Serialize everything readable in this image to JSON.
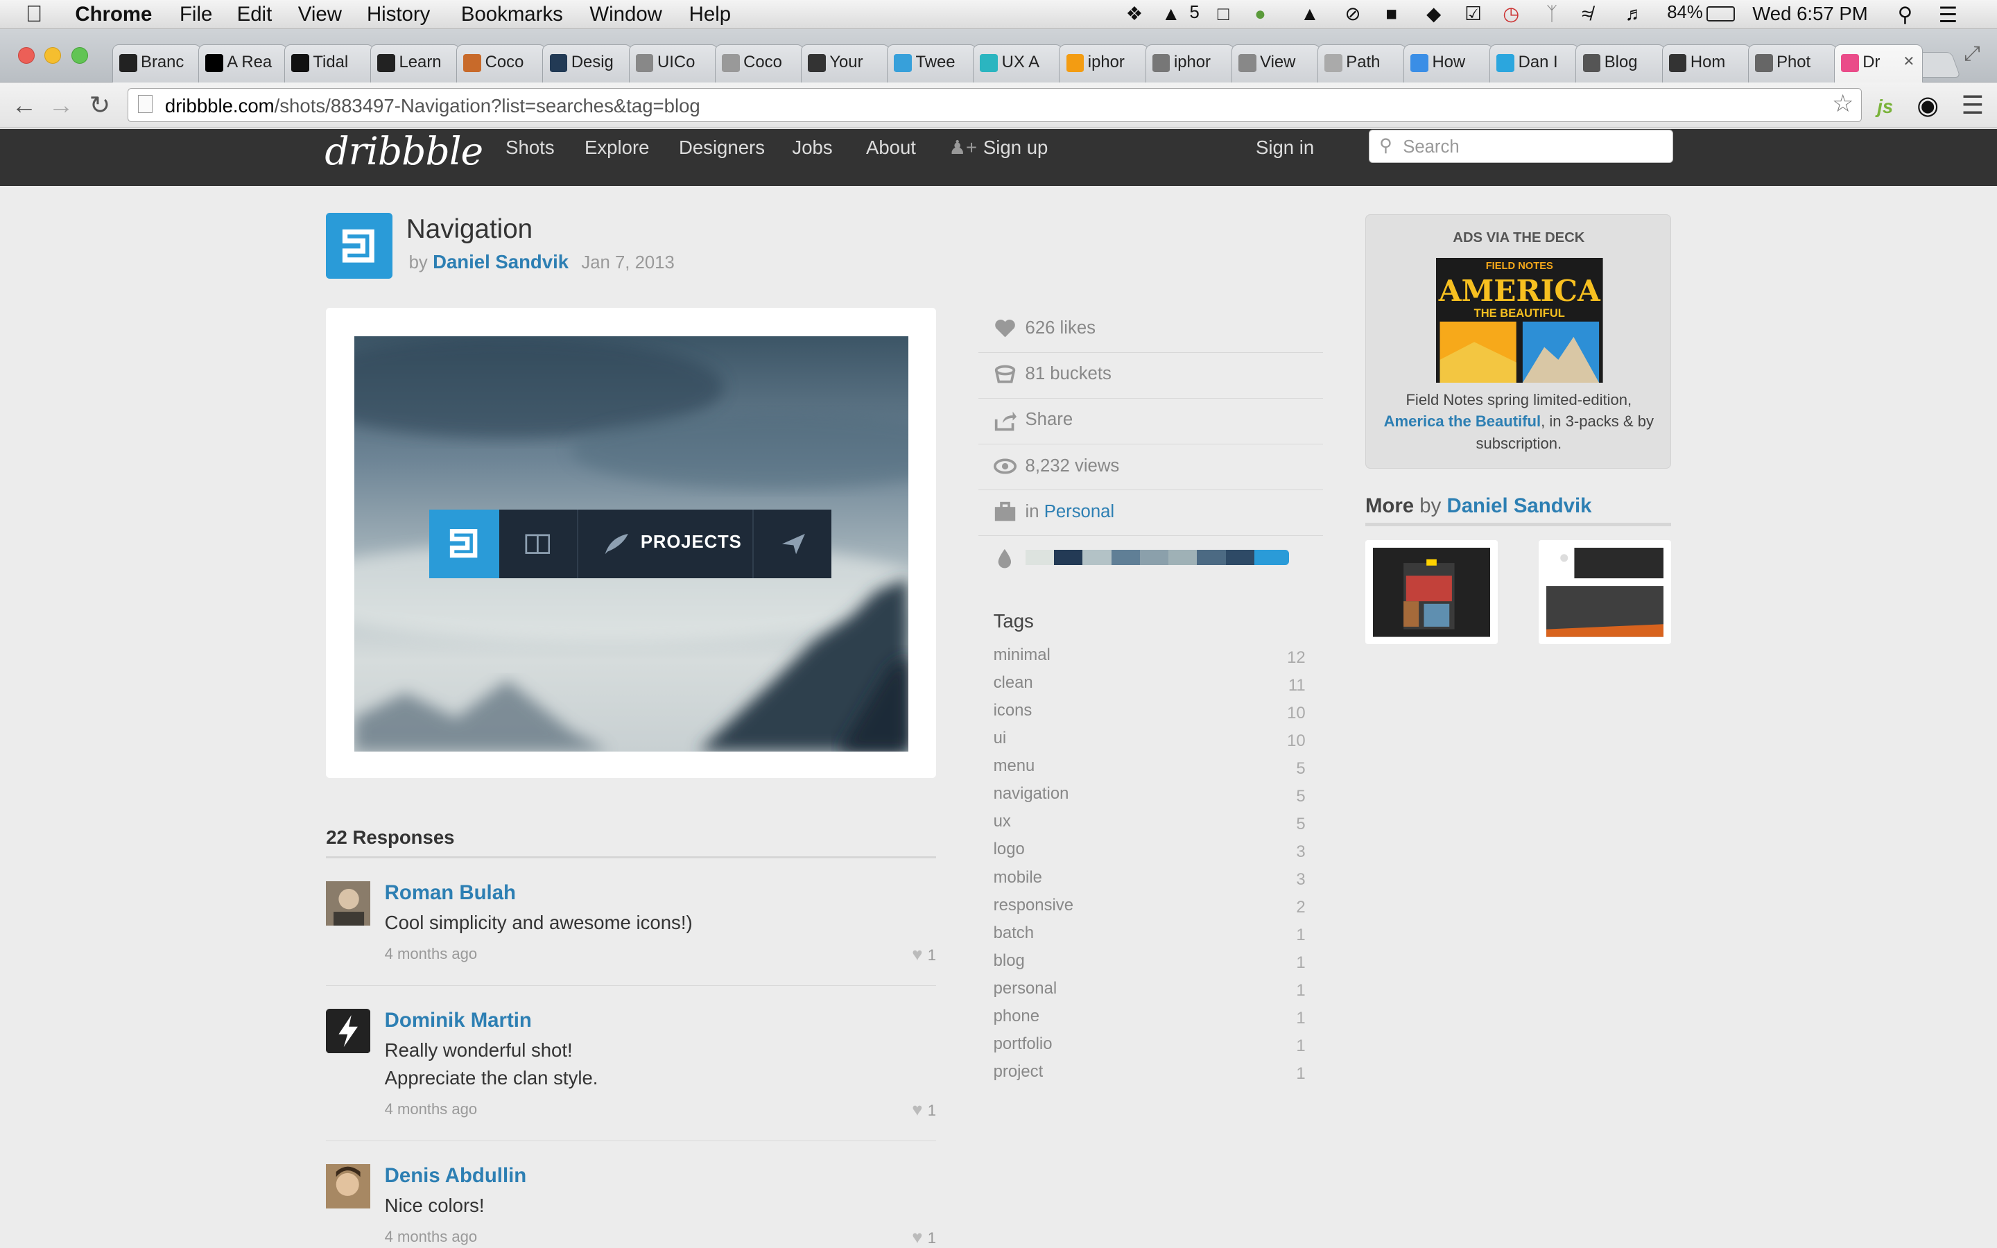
{
  "menubar": {
    "app": "Chrome",
    "items": [
      "File",
      "Edit",
      "View",
      "History",
      "Bookmarks",
      "Window",
      "Help"
    ],
    "battery": "84%",
    "clock": "Wed 6:57 PM",
    "badge": "5"
  },
  "tabs": [
    "Branc",
    "A Rea",
    "Tidal",
    "Learn",
    "Coco",
    "Desig",
    "UICo",
    "Coco",
    "Your",
    "Twee",
    "UX A",
    "iphor",
    "iphor",
    "View",
    "Path",
    "How",
    "Dan I",
    "Blog",
    "Hom",
    "Phot",
    "Dr"
  ],
  "url": {
    "host": "dribbble.com",
    "path": "/shots/883497-Navigation?list=searches&tag=blog"
  },
  "header": {
    "logo": "dribbble",
    "nav": [
      "Shots",
      "Explore",
      "Designers",
      "Jobs",
      "About",
      "Sign up"
    ],
    "signin": "Sign in",
    "search_placeholder": "Search"
  },
  "shot": {
    "title": "Navigation",
    "by": "by",
    "author": "Daniel Sandvik",
    "date": "Jan 7, 2013",
    "nav_label": "PROJECTS"
  },
  "stats": {
    "likes": "626 likes",
    "buckets": "81 buckets",
    "share": "Share",
    "views": "8,232 views",
    "in_prefix": "in",
    "project": "Personal"
  },
  "palette": [
    "#dde3df",
    "#233a55",
    "#b3c2c6",
    "#607f96",
    "#8ba0ab",
    "#9fb1b6",
    "#4c6a83",
    "#2e4a66",
    "#2a9bd8"
  ],
  "tags_title": "Tags",
  "tags": [
    {
      "name": "minimal",
      "count": "12"
    },
    {
      "name": "clean",
      "count": "11"
    },
    {
      "name": "icons",
      "count": "10"
    },
    {
      "name": "ui",
      "count": "10"
    },
    {
      "name": "menu",
      "count": "5"
    },
    {
      "name": "navigation",
      "count": "5"
    },
    {
      "name": "ux",
      "count": "5"
    },
    {
      "name": "logo",
      "count": "3"
    },
    {
      "name": "mobile",
      "count": "3"
    },
    {
      "name": "responsive",
      "count": "2"
    },
    {
      "name": "batch",
      "count": "1"
    },
    {
      "name": "blog",
      "count": "1"
    },
    {
      "name": "personal",
      "count": "1"
    },
    {
      "name": "phone",
      "count": "1"
    },
    {
      "name": "portfolio",
      "count": "1"
    },
    {
      "name": "project",
      "count": "1"
    }
  ],
  "ads": {
    "heading": "ADS VIA THE DECK",
    "img_line1": "FIELD NOTES",
    "img_big": "AMERICA",
    "img_sub": "THE BEAUTIFUL",
    "text_pre": "Field Notes spring limited-edition,",
    "text_link": "America the Beautiful",
    "text_post": ", in 3-packs & by subscription."
  },
  "more": {
    "label": "More",
    "by": "by",
    "author": "Daniel Sandvik"
  },
  "responses": {
    "heading": "22 Responses",
    "items": [
      {
        "name": "Roman Bulah",
        "lines": [
          "Cool simplicity and awesome icons!)"
        ],
        "time": "4 months ago",
        "likes": "1"
      },
      {
        "name": "Dominik Martin",
        "lines": [
          "Really wonderful shot!",
          "Appreciate the clan style."
        ],
        "time": "4 months ago",
        "likes": "1"
      },
      {
        "name": "Denis Abdullin",
        "lines": [
          "Nice colors!"
        ],
        "time": "4 months ago",
        "likes": "1"
      }
    ]
  }
}
